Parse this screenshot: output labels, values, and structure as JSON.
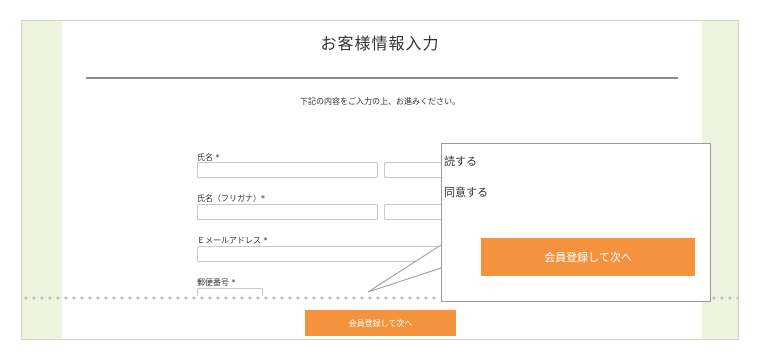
{
  "form": {
    "title": "お客様情報入力",
    "subtitle": "下記の内容をご入力の上、お進みください。",
    "fields": {
      "name_label": "氏名 *",
      "kana_label": "氏名（フリガナ）*",
      "email_label": "Ｅメールアドレス *",
      "postal_label": "郵便番号 *"
    },
    "submit_label": "会員登録して次へ"
  },
  "callout": {
    "read_text": "読する",
    "agree_text": "同意する",
    "button_label": "会員登録して次へ"
  },
  "colors": {
    "accent": "#f5923e",
    "frame_bg": "#eef3df"
  }
}
